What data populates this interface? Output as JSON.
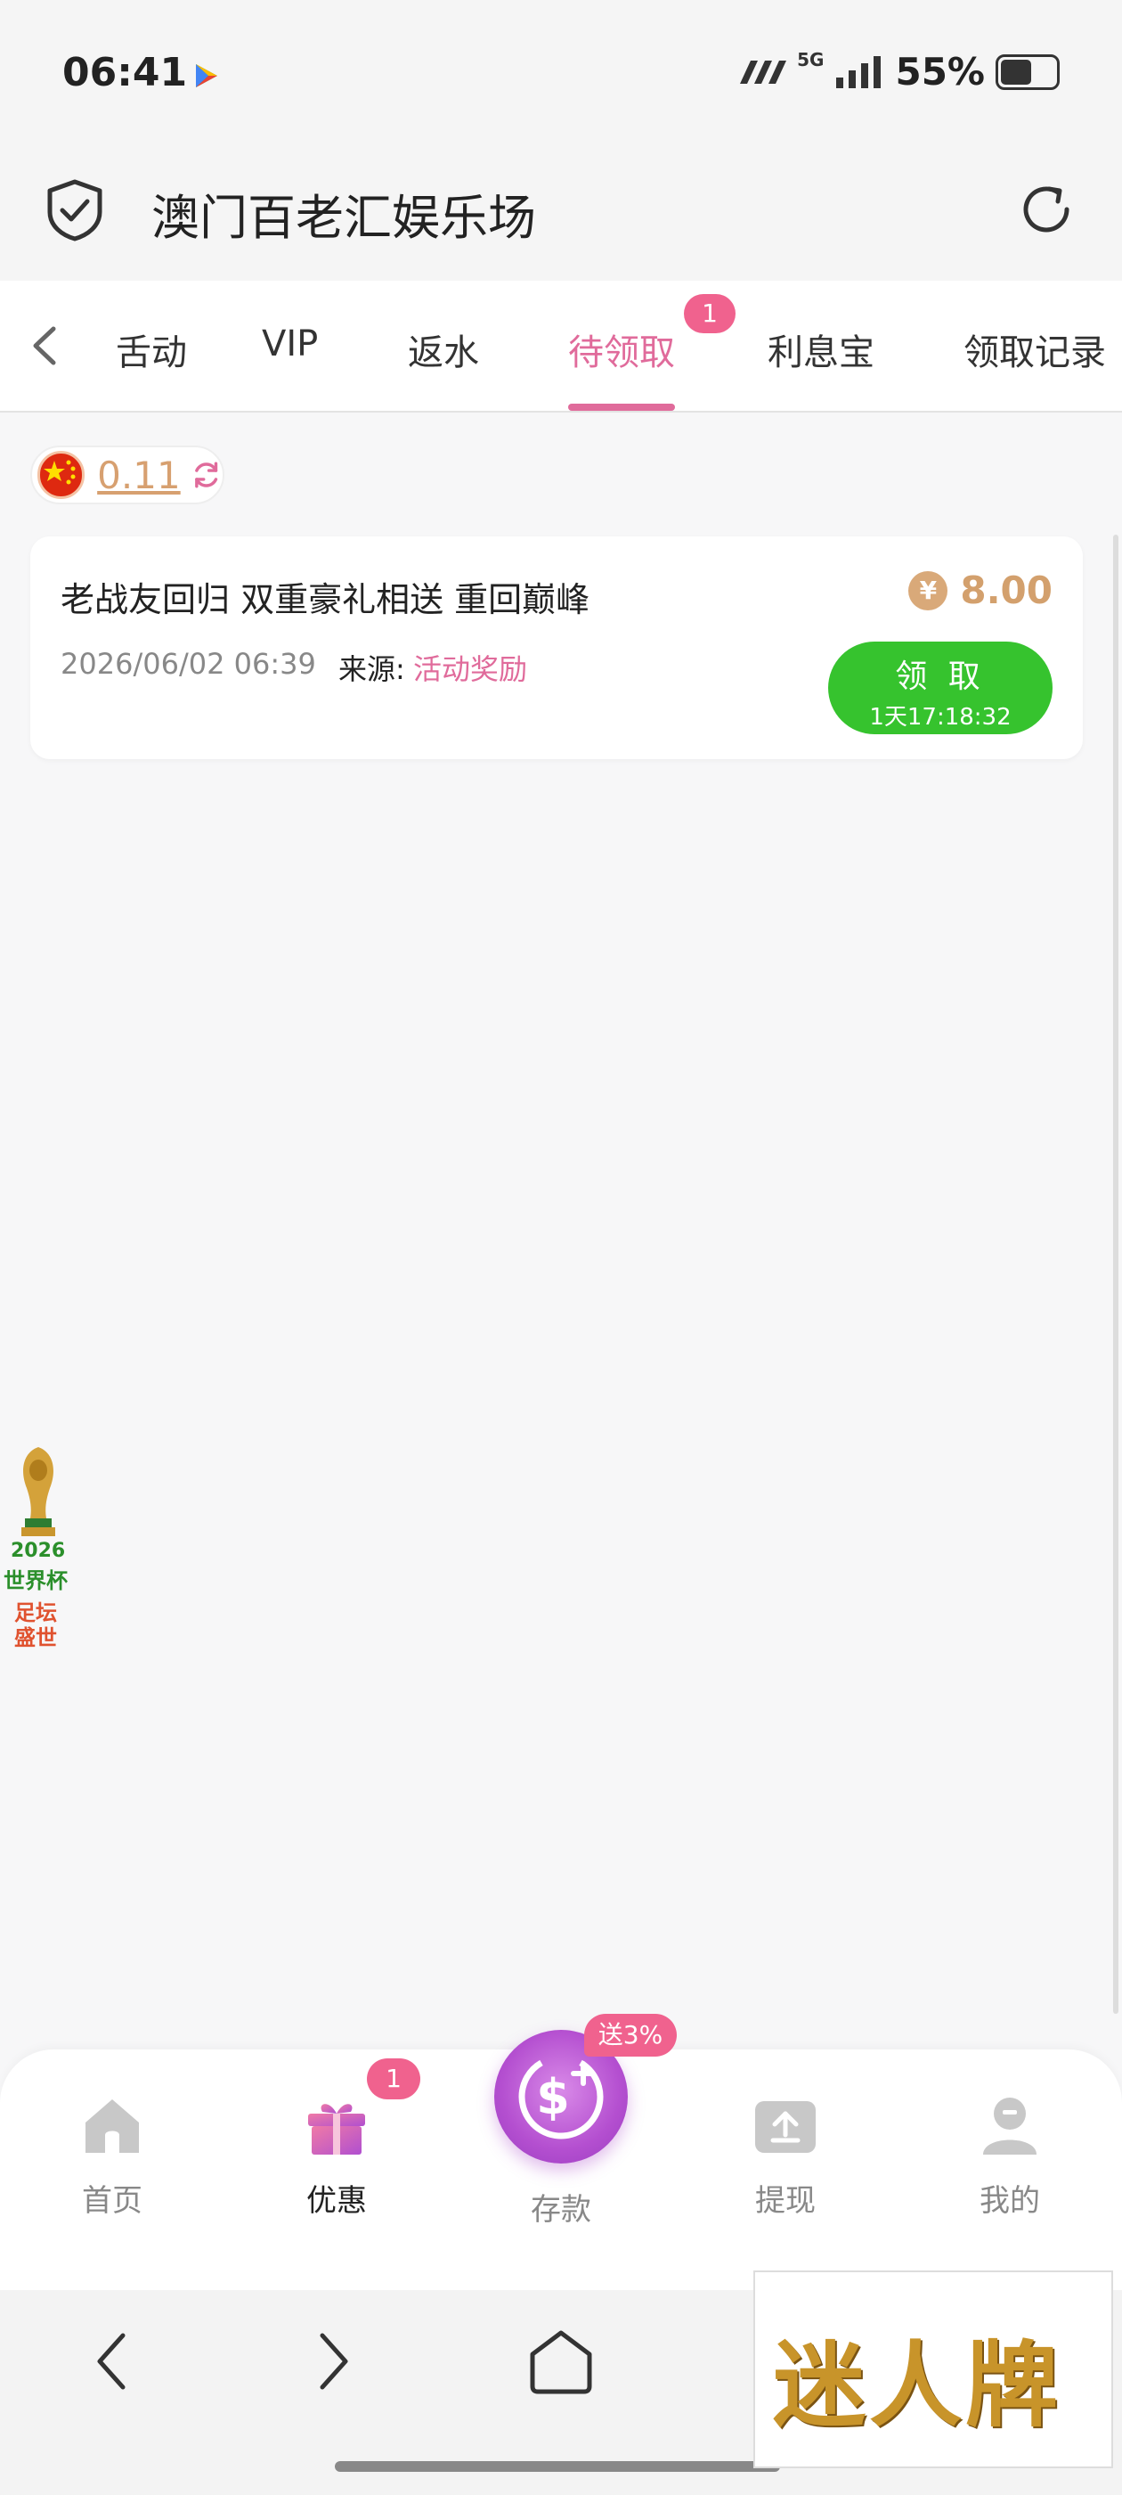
{
  "status_bar": {
    "time": "06:41",
    "network": "5G",
    "battery": "55%",
    "battery_level": 0.55
  },
  "header": {
    "title": "澳门百老汇娱乐场"
  },
  "tabs": {
    "items": [
      {
        "label": "舌动"
      },
      {
        "label": "VIP"
      },
      {
        "label": "返水"
      },
      {
        "label": "待领取"
      },
      {
        "label": "利息宝"
      },
      {
        "label": "领取记录"
      }
    ],
    "active": "待领取",
    "badge": "1"
  },
  "balance": {
    "value": "0.11"
  },
  "reward_card": {
    "title": "老战友回归 双重豪礼相送 重回巅峰",
    "currency_symbol": "¥",
    "amount": "8.00",
    "date": "2026/06/02 06:39",
    "source_label": "来源:",
    "source": "活动奖励",
    "claim_label": "领 取",
    "countdown": "1天17:18:32"
  },
  "world_cup_ad": {
    "year": "2026",
    "name": "世界杯",
    "subtitle": "足坛盛世"
  },
  "bottom_nav": {
    "home": "首页",
    "promo": "优惠",
    "promo_badge": "1",
    "deposit": "存款",
    "deposit_badge": "送3%",
    "withdraw": "提现",
    "mine": "我的"
  },
  "brand": {
    "text": "迷人牌"
  },
  "colors": {
    "accent": "#e06b9b",
    "claim_green": "#36c32e",
    "gold": "#d3a06d"
  }
}
